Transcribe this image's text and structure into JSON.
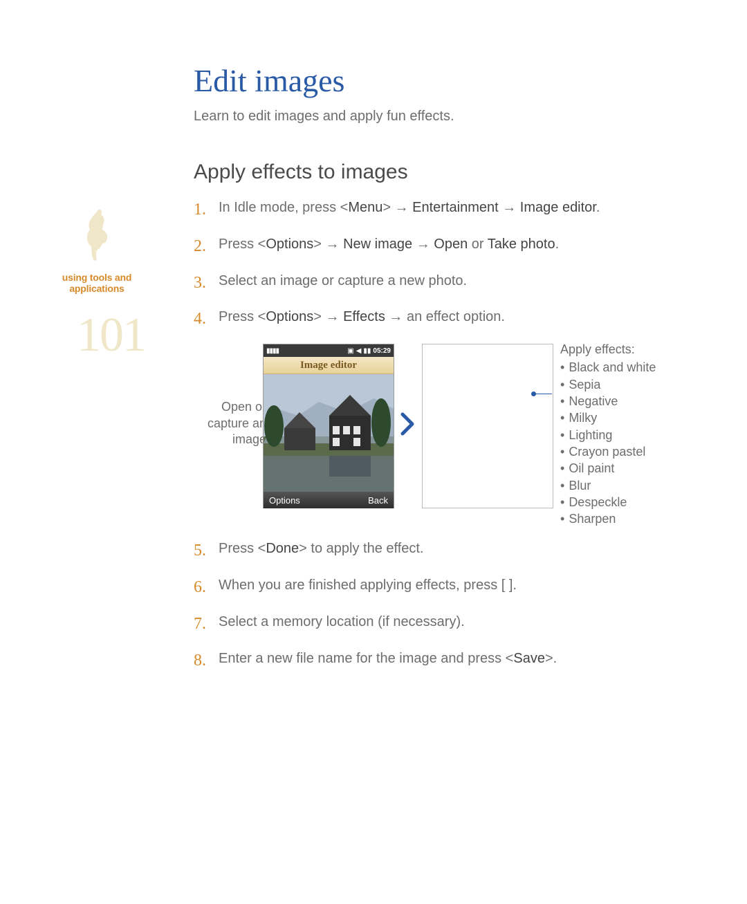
{
  "sidebar": {
    "label_line1": "using tools and",
    "label_line2": "applications",
    "page_number": "101"
  },
  "title": "Edit images",
  "intro": "Learn to edit images and apply fun effects.",
  "subtitle": "Apply effects to images",
  "steps": [
    {
      "n": "1.",
      "pre": "In Idle mode, press <",
      "s1": "Menu",
      "mid1": "> → ",
      "s2": "Entertainment",
      "mid2": " → ",
      "s3": "Image editor",
      "post": "."
    },
    {
      "n": "2.",
      "pre": "Press <",
      "s1": "Options",
      "mid1": "> → ",
      "s2": "New image",
      "mid2": " → ",
      "s3": "Open",
      "mid3": " or ",
      "s4": "Take photo",
      "post": "."
    },
    {
      "n": "3.",
      "text": "Select an image or capture a new photo."
    },
    {
      "n": "4.",
      "pre": "Press <",
      "s1": "Options",
      "mid1": "> → ",
      "s2": "Effects",
      "mid2": " → an effect option."
    }
  ],
  "figure": {
    "caption_left": "Open or capture an image",
    "phone_clock": "05:29",
    "phone_title": "Image editor",
    "phone_left_soft": "Options",
    "phone_right_soft": "Back",
    "effects_header": "Apply effects:",
    "effects": [
      "Black and white",
      "Sepia",
      "Negative",
      "Milky",
      "Lighting",
      "Crayon pastel",
      "Oil paint",
      "Blur",
      "Despeckle",
      "Sharpen"
    ]
  },
  "steps2": [
    {
      "n": "5.",
      "pre": "Press <",
      "s1": "Done",
      "post": "> to apply the effect."
    },
    {
      "n": "6.",
      "text": "When you are finished applying effects, press [   ]."
    },
    {
      "n": "7.",
      "text": "Select a memory location (if necessary)."
    },
    {
      "n": "8.",
      "pre": "Enter a new file name for the image and press <",
      "s1": "Save",
      "post": ">."
    }
  ]
}
